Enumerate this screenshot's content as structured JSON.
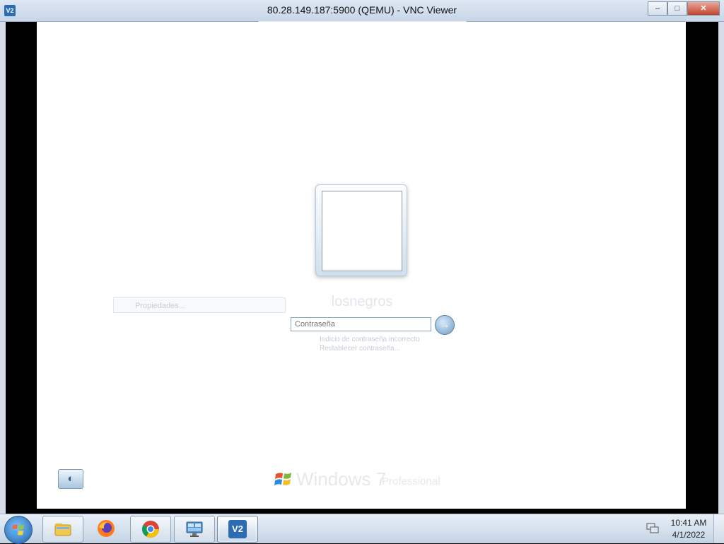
{
  "window": {
    "app_icon_text": "V2",
    "title": "80.28.149.187:5900 (QEMU) - VNC Viewer",
    "minimize_glyph": "–",
    "maximize_glyph": "□",
    "close_glyph": "✕"
  },
  "login": {
    "username": "losnegros",
    "ghost_username_field": "Propiedades...",
    "password_placeholder": "Contraseña",
    "submit_glyph": "→",
    "hint_line1": "Indicio de contraseña incorrecto",
    "hint_line2": "Restablecer contraseña...",
    "ease_of_access_glyph": "◐",
    "branding_word": "Windows 7",
    "branding_edition": "Professional"
  },
  "taskbar": {
    "items": [
      {
        "name": "windows-explorer",
        "icon": "folder-icon",
        "state": "pinned"
      },
      {
        "name": "firefox",
        "icon": "firefox-icon",
        "state": "pinned"
      },
      {
        "name": "chrome",
        "icon": "chrome-icon",
        "state": "pinned"
      },
      {
        "name": "remote-desktop",
        "icon": "network-screen-icon",
        "state": "pinned"
      },
      {
        "name": "vnc-viewer",
        "icon": "vnc-icon",
        "state": "active"
      }
    ],
    "vnc_icon_text": "V2",
    "clock_time": "10:41 AM",
    "clock_date": "4/1/2022"
  },
  "colors": {
    "title_text": "#111111",
    "taskbar_top": "#e8eff7",
    "taskbar_bottom": "#c3d3e4",
    "remote_background": "#ffffff"
  }
}
